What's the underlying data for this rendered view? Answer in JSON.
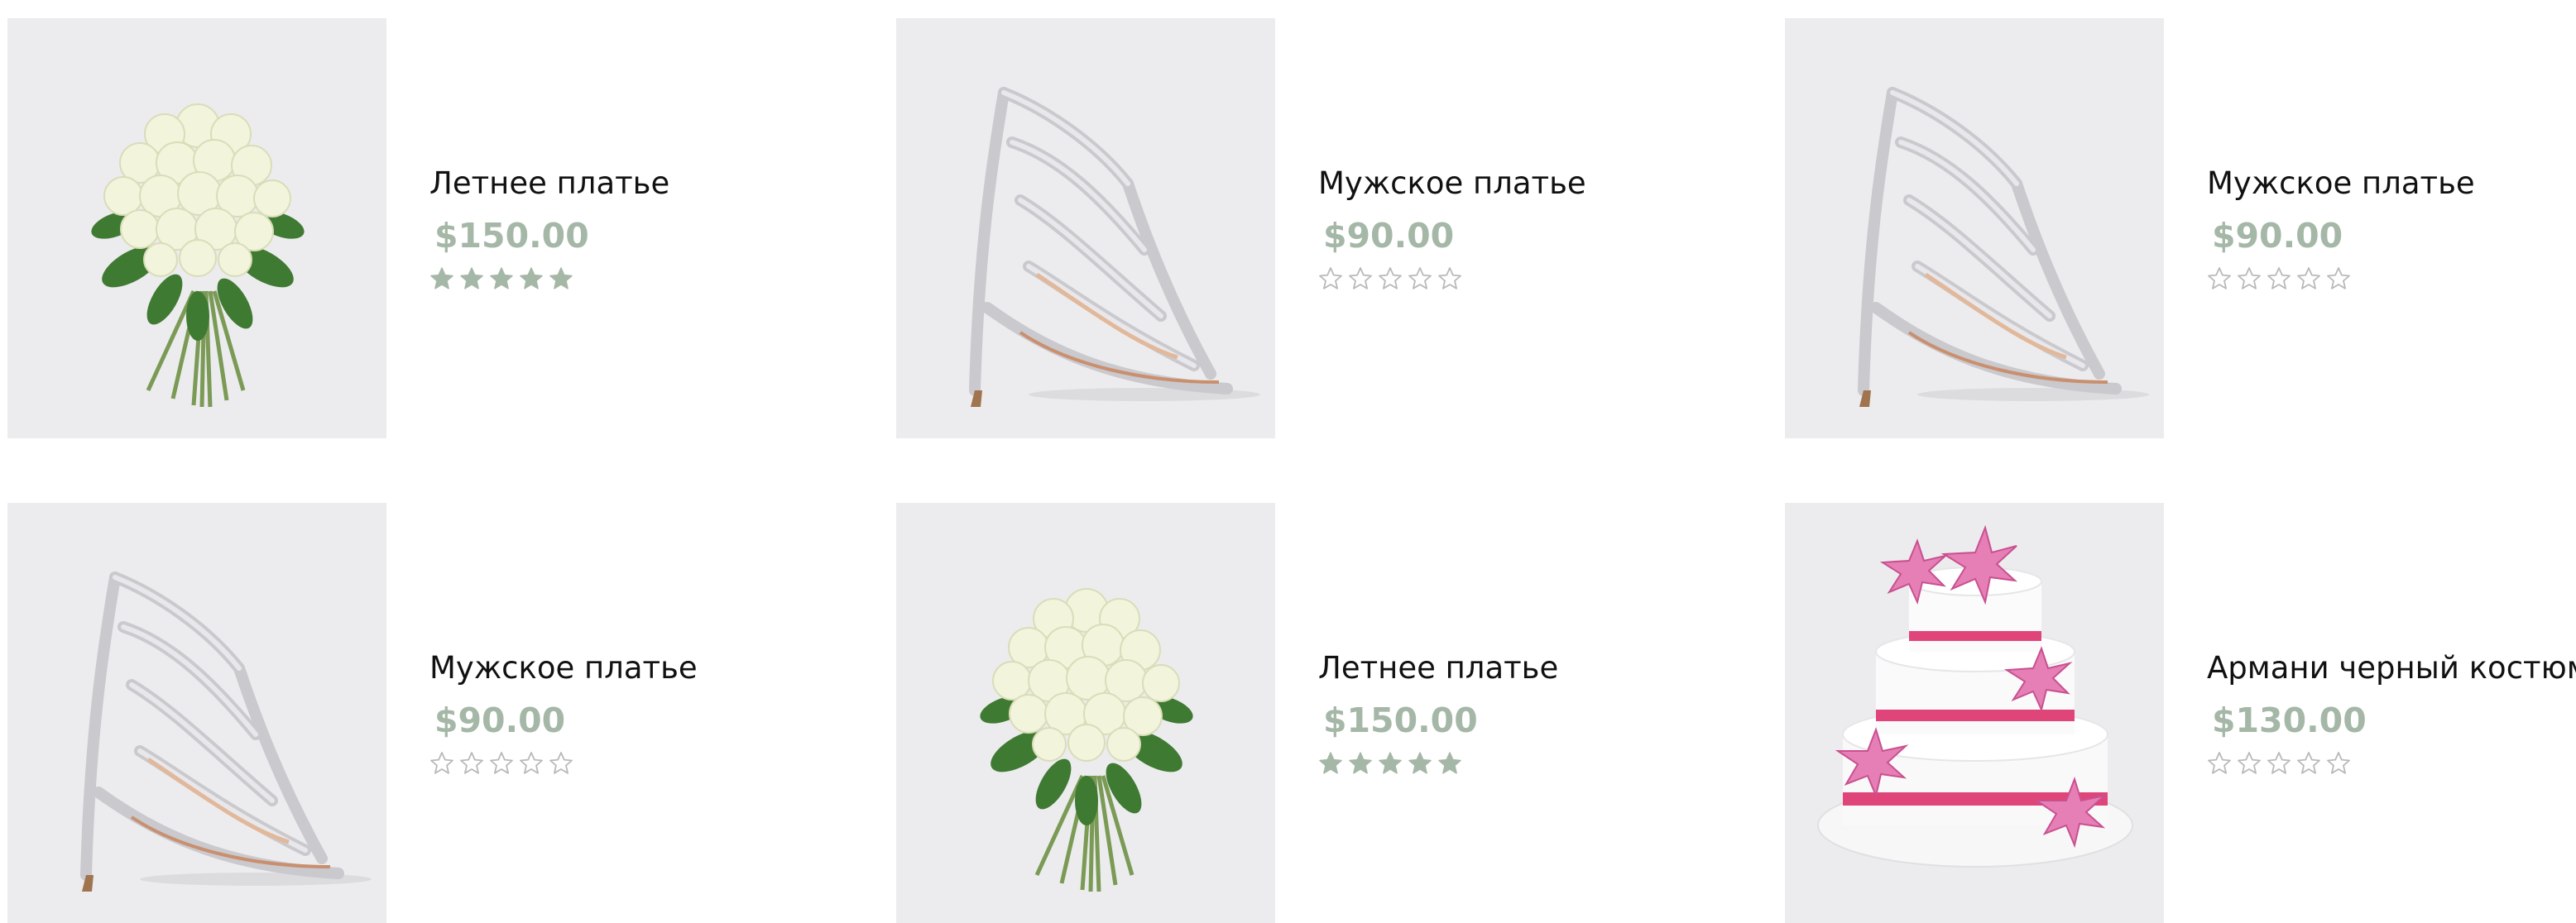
{
  "colors": {
    "price": "#a5b7a7",
    "star_filled": "#a5b7a7",
    "star_empty_stroke": "#b9b9b9",
    "thumb_bg": "#eeeef0",
    "title": "#111111"
  },
  "products": [
    {
      "title": "Летнее платье",
      "price": "$150.00",
      "rating": 5,
      "image": "white-rose-bouquet"
    },
    {
      "title": "Мужское платье",
      "price": "$90.00",
      "rating": 0,
      "image": "silver-strappy-heel"
    },
    {
      "title": "Мужское платье",
      "price": "$90.00",
      "rating": 0,
      "image": "silver-strappy-heel"
    },
    {
      "title": "Мужское платье",
      "price": "$90.00",
      "rating": 0,
      "image": "silver-strappy-heel"
    },
    {
      "title": "Летнее платье",
      "price": "$150.00",
      "rating": 5,
      "image": "white-rose-bouquet"
    },
    {
      "title": "Армани черный костюм",
      "price": "$130.00",
      "rating": 0,
      "image": "three-tier-lily-cake"
    }
  ]
}
